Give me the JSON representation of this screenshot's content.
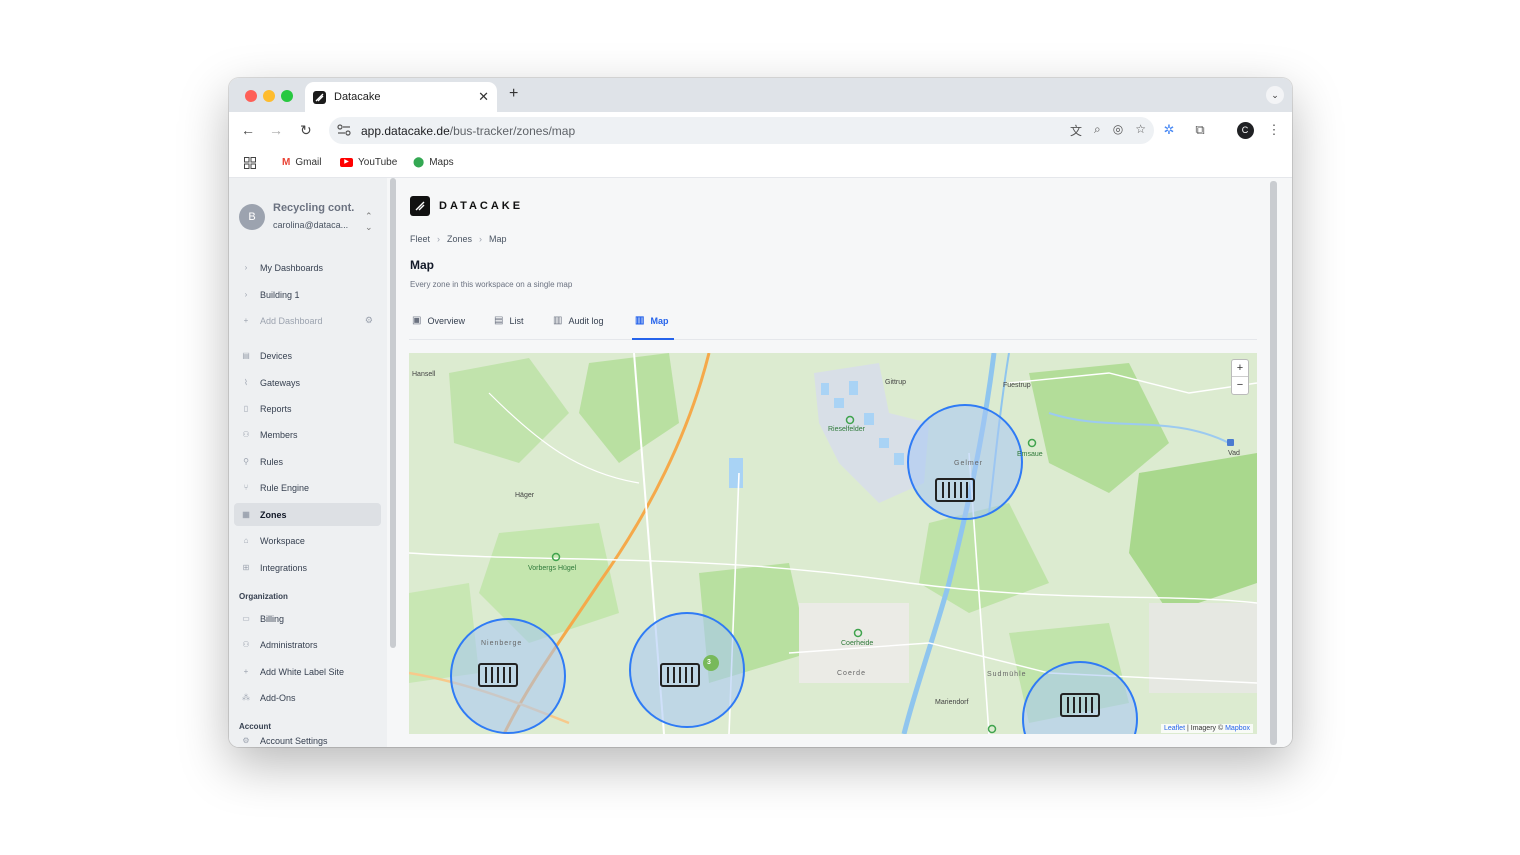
{
  "browser": {
    "tab_title": "Datacake",
    "new_tab": "+",
    "url_host": "app.datacake.de",
    "url_path": "/bus-tracker/zones/map",
    "profile_initial": "C",
    "bookmarks": [
      {
        "label": "Gmail",
        "icon": "gmail-icon"
      },
      {
        "label": "YouTube",
        "icon": "youtube-icon"
      },
      {
        "label": "Maps",
        "icon": "maps-icon"
      }
    ]
  },
  "workspace": {
    "initial": "B",
    "name": "Recycling cont.",
    "email": "carolina@dataca..."
  },
  "sidebar": {
    "dashboards": [
      {
        "label": "My Dashboards"
      },
      {
        "label": "Building 1"
      },
      {
        "label": "Add Dashboard"
      }
    ],
    "items": [
      {
        "label": "Devices",
        "icon": "devices-icon"
      },
      {
        "label": "Gateways",
        "icon": "gateways-icon"
      },
      {
        "label": "Reports",
        "icon": "reports-icon"
      },
      {
        "label": "Members",
        "icon": "members-icon"
      },
      {
        "label": "Rules",
        "icon": "rules-icon"
      },
      {
        "label": "Rule Engine",
        "icon": "rule-engine-icon"
      },
      {
        "label": "Zones",
        "icon": "zones-icon",
        "active": true
      },
      {
        "label": "Workspace",
        "icon": "workspace-icon"
      },
      {
        "label": "Integrations",
        "icon": "integrations-icon"
      }
    ],
    "organization_label": "Organization",
    "organization_items": [
      {
        "label": "Billing"
      },
      {
        "label": "Administrators"
      },
      {
        "label": "Add White Label Site"
      },
      {
        "label": "Add-Ons"
      }
    ],
    "account_label": "Account",
    "account_items": [
      {
        "label": "Account Settings"
      }
    ]
  },
  "main": {
    "logo_text": "DATACAKE",
    "breadcrumb": [
      "Fleet",
      "Zones",
      "Map"
    ],
    "title": "Map",
    "subtitle": "Every zone in this workspace on a single map",
    "tabs": [
      {
        "label": "Overview"
      },
      {
        "label": "List"
      },
      {
        "label": "Audit log"
      },
      {
        "label": "Map",
        "active": true
      }
    ]
  },
  "map": {
    "zoom_in": "+",
    "zoom_out": "−",
    "attribution_leaflet": "Leaflet",
    "attribution_text": "| Imagery ©",
    "attribution_mapbox": "Mapbox",
    "cluster_count": "3",
    "place_labels": [
      "Hansell",
      "Gittrup",
      "Fuestrup",
      "Häger",
      "Vorbergs Hügel",
      "Rieselfelder",
      "Emsaue",
      "Gelmer",
      "Coerde",
      "Sudmühle",
      "Mariendorf",
      "Vad",
      "Nienberge",
      "Coerheide"
    ],
    "colors": {
      "zone_stroke": "#2f7bf5",
      "zone_fill": "#a8c6f5",
      "water": "#a9d3f5",
      "park": "#b9e3a0",
      "road": "#f5a94a"
    }
  }
}
